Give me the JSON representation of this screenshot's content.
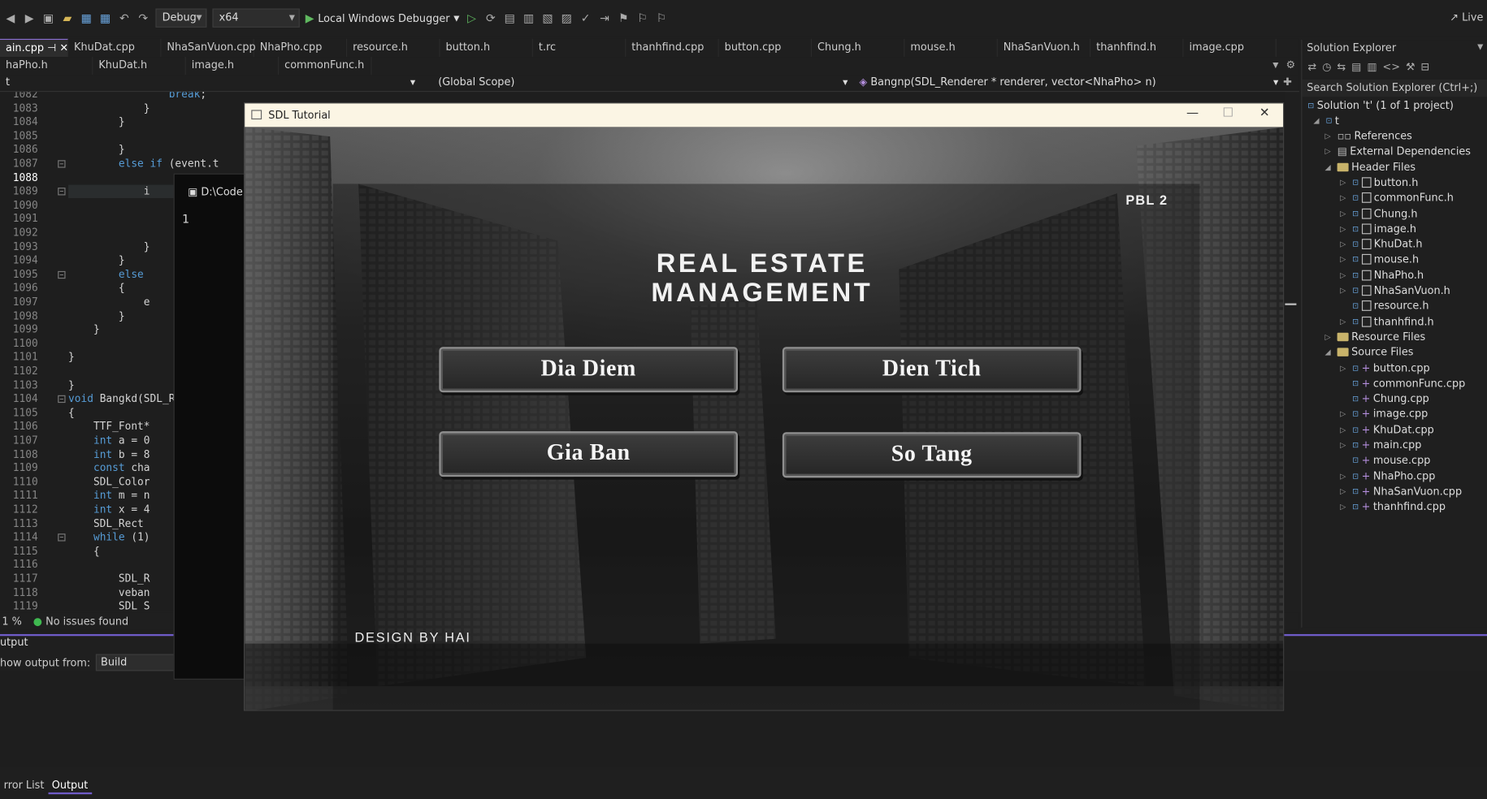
{
  "toolbar": {
    "config": "Debug",
    "platform": "x64",
    "run_label": "Local Windows Debugger",
    "live_label": "Live"
  },
  "tabs_row1": [
    {
      "label": "ain.cpp",
      "pin": "⊣",
      "close": "✕"
    },
    {
      "label": "KhuDat.cpp"
    },
    {
      "label": "NhaSanVuon.cpp"
    },
    {
      "label": "NhaPho.cpp"
    },
    {
      "label": "resource.h"
    },
    {
      "label": "button.h"
    },
    {
      "label": "t.rc"
    },
    {
      "label": "thanhfind.cpp"
    },
    {
      "label": "button.cpp"
    },
    {
      "label": "Chung.h"
    },
    {
      "label": "mouse.h"
    },
    {
      "label": "NhaSanVuon.h"
    },
    {
      "label": "thanhfind.h"
    },
    {
      "label": "image.cpp"
    }
  ],
  "tabs_row2": [
    {
      "label": "haPho.h"
    },
    {
      "label": "KhuDat.h"
    },
    {
      "label": "image.h"
    },
    {
      "label": "commonFunc.h"
    }
  ],
  "navbar": {
    "project": "t",
    "scope": "(Global Scope)",
    "function": "Bangnp(SDL_Renderer * renderer, vector<NhaPho> n)"
  },
  "editor": {
    "lines": [
      {
        "n": "1082",
        "code": "                break;"
      },
      {
        "n": "1083",
        "code": "            }"
      },
      {
        "n": "1084",
        "code": "        }"
      },
      {
        "n": "1085",
        "code": ""
      },
      {
        "n": "1086",
        "code": "        }"
      },
      {
        "n": "1087",
        "code": "        else if (event.t"
      },
      {
        "n": "1088",
        "code": ""
      },
      {
        "n": "1089",
        "code": "            i"
      },
      {
        "n": "1090",
        "code": ""
      },
      {
        "n": "1091",
        "code": ""
      },
      {
        "n": "1092",
        "code": ""
      },
      {
        "n": "1093",
        "code": "            }"
      },
      {
        "n": "1094",
        "code": "        }"
      },
      {
        "n": "1095",
        "code": "        else"
      },
      {
        "n": "1096",
        "code": "        {"
      },
      {
        "n": "1097",
        "code": "            e"
      },
      {
        "n": "1098",
        "code": "        }"
      },
      {
        "n": "1099",
        "code": "    }"
      },
      {
        "n": "1100",
        "code": ""
      },
      {
        "n": "1101",
        "code": "}"
      },
      {
        "n": "1102",
        "code": ""
      },
      {
        "n": "1103",
        "code": "}"
      },
      {
        "n": "1104",
        "code": "void Bangkd(SDL_R"
      },
      {
        "n": "1105",
        "code": "{"
      },
      {
        "n": "1106",
        "code": "    TTF_Font*"
      },
      {
        "n": "1107",
        "code": "    int a = 0"
      },
      {
        "n": "1108",
        "code": "    int b = 8"
      },
      {
        "n": "1109",
        "code": "    const cha"
      },
      {
        "n": "1110",
        "code": "    SDL_Color"
      },
      {
        "n": "1111",
        "code": "    int m = n"
      },
      {
        "n": "1112",
        "code": "    int x = 4"
      },
      {
        "n": "1113",
        "code": "    SDL_Rect "
      },
      {
        "n": "1114",
        "code": "    while (1)"
      },
      {
        "n": "1115",
        "code": "    {"
      },
      {
        "n": "1116",
        "code": ""
      },
      {
        "n": "1117",
        "code": "        SDL_R"
      },
      {
        "n": "1118",
        "code": "        veban"
      },
      {
        "n": "1119",
        "code": "        SDL_S"
      }
    ]
  },
  "status": {
    "zoom": "1 %",
    "issues": "No issues found"
  },
  "output": {
    "header": "utput",
    "show_from_label": "how output from:",
    "show_from_value": "Build"
  },
  "bottom_tabs": [
    "rror List",
    "Output"
  ],
  "console": {
    "title": "D:\\Code",
    "content": "1"
  },
  "solution_explorer": {
    "header": "Solution Explorer",
    "search_placeholder": "Search Solution Explorer (Ctrl+;)",
    "solution": "Solution 't' (1 of 1 project)",
    "project": "t",
    "items": [
      {
        "label": "References",
        "kind": "ref",
        "depth": 1
      },
      {
        "label": "External Dependencies",
        "kind": "ext",
        "depth": 1
      },
      {
        "label": "Header Files",
        "kind": "folder",
        "depth": 1
      },
      {
        "label": "button.h",
        "kind": "h",
        "depth": 2
      },
      {
        "label": "commonFunc.h",
        "kind": "h",
        "depth": 2
      },
      {
        "label": "Chung.h",
        "kind": "h",
        "depth": 2
      },
      {
        "label": "image.h",
        "kind": "h",
        "depth": 2
      },
      {
        "label": "KhuDat.h",
        "kind": "h",
        "depth": 2
      },
      {
        "label": "mouse.h",
        "kind": "h",
        "depth": 2
      },
      {
        "label": "NhaPho.h",
        "kind": "h",
        "depth": 2
      },
      {
        "label": "NhaSanVuon.h",
        "kind": "h",
        "depth": 2
      },
      {
        "label": "resource.h",
        "kind": "h",
        "depth": 2
      },
      {
        "label": "thanhfind.h",
        "kind": "h",
        "depth": 2
      },
      {
        "label": "Resource Files",
        "kind": "folder",
        "depth": 1
      },
      {
        "label": "Source Files",
        "kind": "folder",
        "depth": 1
      },
      {
        "label": "button.cpp",
        "kind": "cpp",
        "depth": 2
      },
      {
        "label": "commonFunc.cpp",
        "kind": "cpp",
        "depth": 2
      },
      {
        "label": "Chung.cpp",
        "kind": "cpp",
        "depth": 2
      },
      {
        "label": "image.cpp",
        "kind": "cpp",
        "depth": 2
      },
      {
        "label": "KhuDat.cpp",
        "kind": "cpp",
        "depth": 2
      },
      {
        "label": "main.cpp",
        "kind": "cpp",
        "depth": 2
      },
      {
        "label": "mouse.cpp",
        "kind": "cpp",
        "depth": 2
      },
      {
        "label": "NhaPho.cpp",
        "kind": "cpp",
        "depth": 2
      },
      {
        "label": "NhaSanVuon.cpp",
        "kind": "cpp",
        "depth": 2
      },
      {
        "label": "thanhfind.cpp",
        "kind": "cpp",
        "depth": 2
      }
    ]
  },
  "sdl_window": {
    "title": "SDL Tutorial",
    "badge": "PBL 2",
    "heading_line1": "REAL ESTATE",
    "heading_line2": "MANAGEMENT",
    "buttons": {
      "dia_diem": "Dia Diem",
      "dien_tich": "Dien Tich",
      "gia_ban": "Gia Ban",
      "so_tang": "So Tang"
    },
    "footer": "DESIGN BY HAI"
  }
}
